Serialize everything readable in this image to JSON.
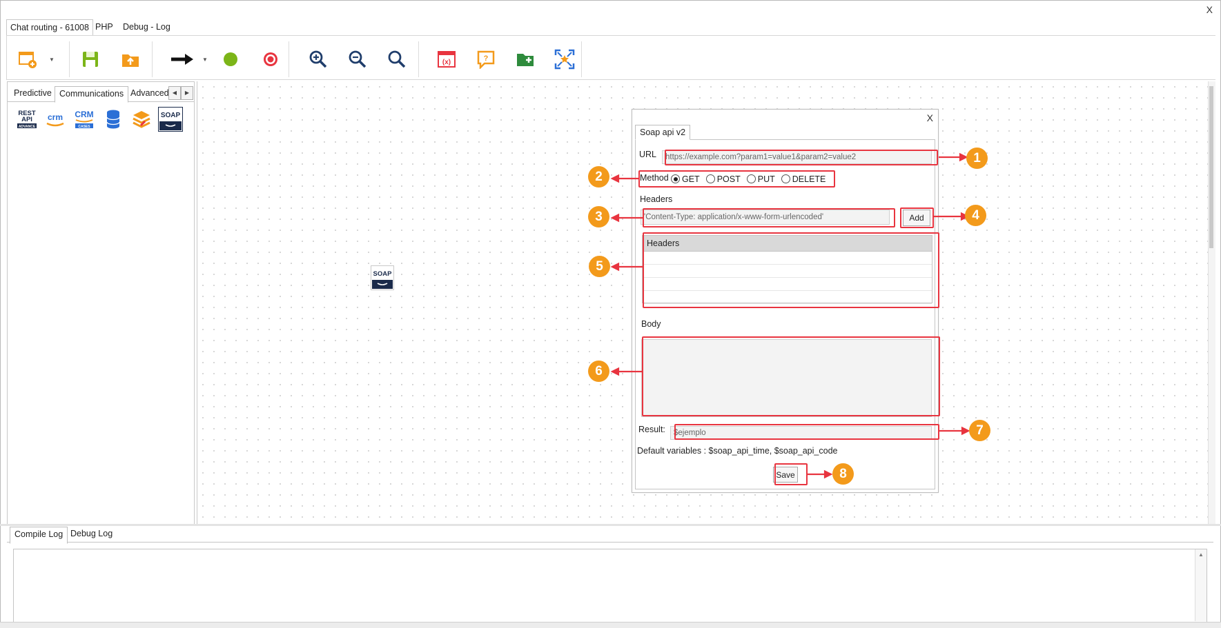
{
  "window": {
    "close_label": "X"
  },
  "top_tabs": [
    {
      "label": "Chat routing - 61008",
      "active": true
    },
    {
      "label": "PHP",
      "active": false
    },
    {
      "label": "Debug - Log",
      "active": false
    }
  ],
  "toolbar": {
    "buttons": [
      {
        "name": "new-flow-icon",
        "color": "#f39a1b"
      },
      {
        "name": "save-icon",
        "color": "#7cb518"
      },
      {
        "name": "upload-icon",
        "color": "#f39a1b"
      },
      {
        "name": "connector-arrow-icon",
        "color": "#111111"
      },
      {
        "name": "start-node-icon",
        "color": "#7cb518"
      },
      {
        "name": "end-node-icon",
        "color": "#e8343f"
      },
      {
        "name": "zoom-in-icon",
        "color": "#1f3d6b"
      },
      {
        "name": "zoom-out-icon",
        "color": "#1f3d6b"
      },
      {
        "name": "zoom-reset-icon",
        "color": "#1f3d6b"
      },
      {
        "name": "variables-icon",
        "color": "#e8343f"
      },
      {
        "name": "prompt-icon",
        "color": "#f39a1b"
      },
      {
        "name": "add-folder-icon",
        "color": "#2e8b3c"
      },
      {
        "name": "fit-screen-icon",
        "color": "#2b6fd6"
      }
    ]
  },
  "left_panel": {
    "tabs": [
      {
        "label": "Predictive",
        "active": false
      },
      {
        "label": "Communications",
        "active": true
      },
      {
        "label": "Advanced",
        "active": false
      }
    ],
    "tools": [
      {
        "name": "rest-api-icon",
        "label_line1": "REST",
        "label_line2": "API",
        "label_line3": "ADVANCE"
      },
      {
        "name": "crm-icon",
        "label": "crm"
      },
      {
        "name": "crm-cases-icon",
        "label": "CRM",
        "sub": "CASES"
      },
      {
        "name": "database-icon"
      },
      {
        "name": "layers-icon"
      },
      {
        "name": "soap-icon",
        "label": "SOAP"
      }
    ]
  },
  "canvas": {
    "node": {
      "label": "SOAP"
    }
  },
  "dialog": {
    "close_label": "X",
    "tab_label": "Soap api v2",
    "url_label": "URL",
    "url_placeholder": "https://example.com?param1=value1&param2=value2",
    "method_label": "Method",
    "methods": [
      {
        "label": "GET",
        "selected": true
      },
      {
        "label": "POST",
        "selected": false
      },
      {
        "label": "PUT",
        "selected": false
      },
      {
        "label": "DELETE",
        "selected": false
      }
    ],
    "headers_label": "Headers",
    "header_placeholder": "'Content-Type: application/x-www-form-urlencoded'",
    "add_label": "Add",
    "grid_header": "Headers",
    "body_label": "Body",
    "result_label": "Result:",
    "result_placeholder": "$ejemplo",
    "default_vars": "Default variables : $soap_api_time, $soap_api_code",
    "save_label": "Save"
  },
  "callouts": [
    "1",
    "2",
    "3",
    "4",
    "5",
    "6",
    "7",
    "8"
  ],
  "accent_colors": {
    "callout": "#f39a1b",
    "highlight": "#e8343f"
  },
  "bottom_panel": {
    "tabs": [
      {
        "label": "Compile Log",
        "active": true
      },
      {
        "label": "Debug Log",
        "active": false
      }
    ]
  }
}
